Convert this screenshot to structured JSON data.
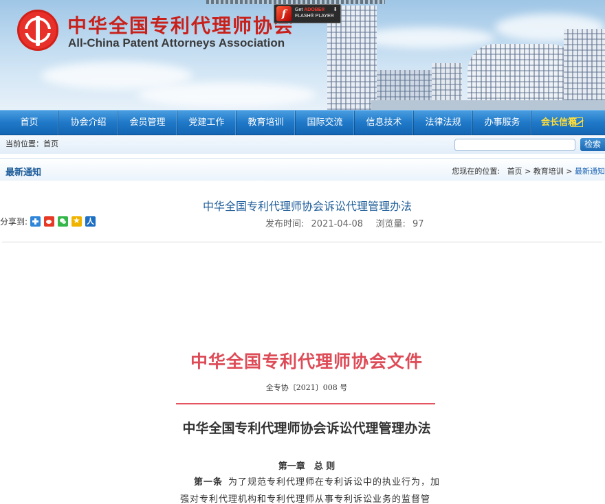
{
  "header": {
    "site_name_cn": "中华全国专利代理师协会",
    "site_name_en": "All-China Patent Attorneys Association",
    "flash_badge": {
      "line1_prefix": "Get ",
      "line1_brand": "ADOBE®",
      "line2": "FLASH® PLAYER"
    }
  },
  "nav": {
    "items": [
      "首页",
      "协会介绍",
      "会员管理",
      "党建工作",
      "教育培训",
      "国际交流",
      "信息技术",
      "法律法规",
      "办事服务"
    ],
    "special_item": "会长信箱"
  },
  "location_bar": {
    "current_location": "当前位置：首页",
    "search_placeholder": "",
    "search_button": "检索"
  },
  "section": {
    "title": "最新通知",
    "breadcrumb_prefix": "您现在的位置:",
    "breadcrumb": [
      "首页",
      "教育培训",
      "最新通知"
    ],
    "separator": ">"
  },
  "article": {
    "title": "中华全国专利代理师协会诉讼代理管理办法",
    "share_label": "分享到:",
    "publish_label": "发布时间:",
    "publish_date": "2021-04-08",
    "views_label": "浏览量:",
    "views": "97"
  },
  "document": {
    "header": "中华全国专利代理师协会文件",
    "doc_number": "全专协〔2021〕008 号",
    "title": "中华全国专利代理师协会诉讼代理管理办法",
    "chapter": "第一章　总 则",
    "article_label": "第一条",
    "para_line1": "为了规范专利代理师在专利诉讼中的执业行为，加",
    "para_line2": "强对专利代理机构和专利代理师从事专利诉讼业务的监督管理，"
  },
  "colors": {
    "nav_blue": "#1f78c8",
    "title_blue": "#1f5d9a",
    "logo_red": "#e8302a",
    "doc_red": "#dd4b57",
    "special_yellow": "#ffde3a"
  }
}
